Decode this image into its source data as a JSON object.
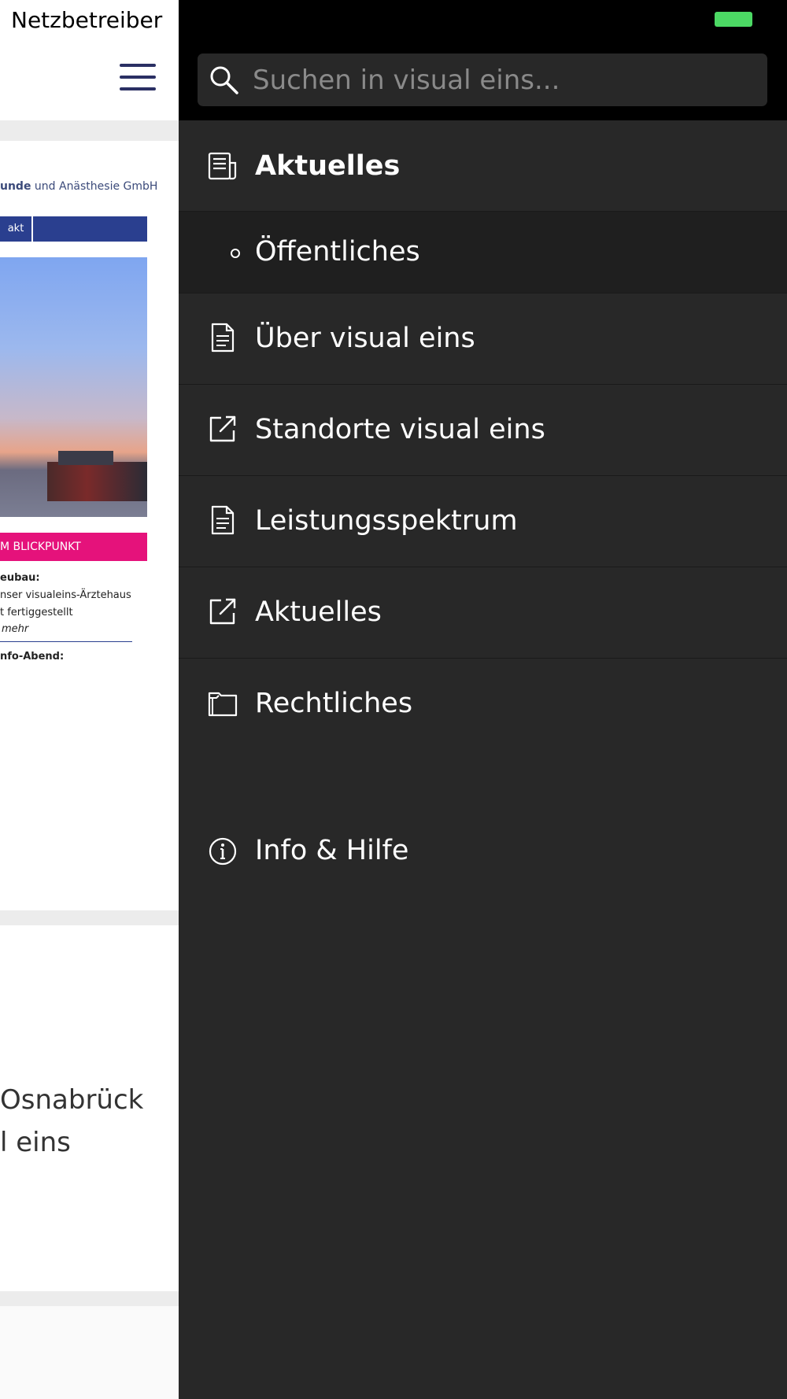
{
  "status_bar": {
    "carrier": "Netzbetreiber"
  },
  "background": {
    "thumb": {
      "title_bold": "unde",
      "title_rest": " und Anästhesie GmbH",
      "nav_tab": "akt",
      "pink_bar": "M BLICKPUNKT",
      "lines": [
        "eubau:",
        "nser visualeins-Ärztehaus",
        "t fertiggestellt",
        "mehr",
        "nfo-Abend:"
      ]
    },
    "teaser_lines": [
      "Osnabrück",
      "l eins"
    ]
  },
  "search": {
    "placeholder": "Suchen in visual eins..."
  },
  "menu": {
    "items": [
      {
        "label": "Aktuelles",
        "icon": "news-icon"
      },
      {
        "label": "Öffentliches",
        "icon": "bullet-icon"
      },
      {
        "label": "Über visual eins",
        "icon": "document-icon"
      },
      {
        "label": "Standorte visual eins",
        "icon": "external-link-icon"
      },
      {
        "label": "Leistungsspektrum",
        "icon": "document-icon"
      },
      {
        "label": "Aktuelles",
        "icon": "external-link-icon"
      },
      {
        "label": "Rechtliches",
        "icon": "folder-icon"
      }
    ],
    "info": {
      "label": "Info & Hilfe",
      "icon": "info-icon"
    }
  },
  "colors": {
    "drawer_bg": "#282828",
    "header_bg": "#000000",
    "battery": "#4cd964",
    "brand_navy": "#2a3f8f",
    "brand_pink": "#e5127b"
  }
}
